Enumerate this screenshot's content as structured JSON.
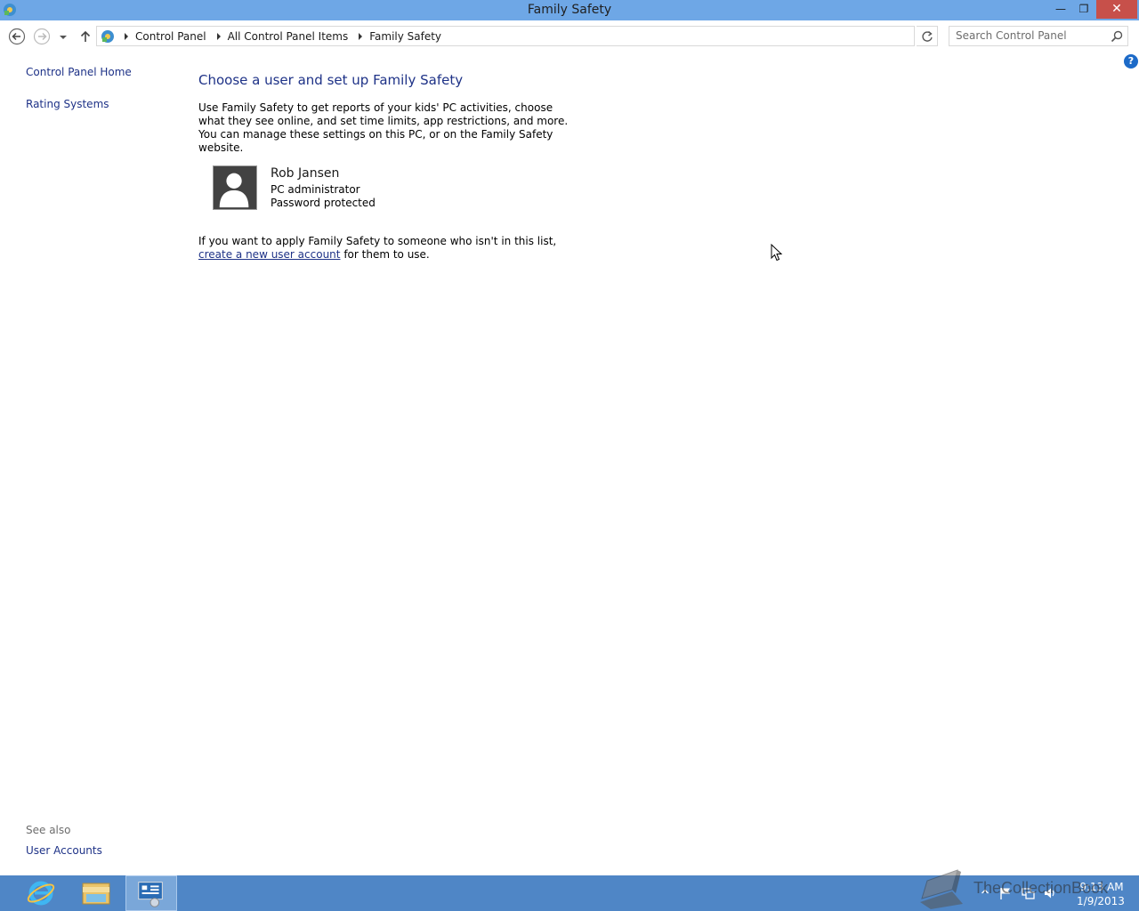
{
  "window": {
    "title": "Family Safety",
    "min_glyph": "—",
    "max_glyph": "❐",
    "close_glyph": "✕"
  },
  "address": {
    "crumbs": [
      "Control Panel",
      "All Control Panel Items",
      "Family Safety"
    ]
  },
  "search": {
    "placeholder": "Search Control Panel"
  },
  "leftnav": {
    "home": "Control Panel Home",
    "rating": "Rating Systems",
    "see_also": "See also",
    "user_accounts": "User Accounts"
  },
  "help": {
    "glyph": "?"
  },
  "main": {
    "heading": "Choose a user and set up Family Safety",
    "intro": "Use Family Safety to get reports of your kids' PC activities, choose what they see online, and set time limits, app restrictions, and more. You can manage these settings on this PC, or on the Family Safety website.",
    "user": {
      "name": "Rob Jansen",
      "role": "PC administrator",
      "status": "Password protected"
    },
    "apply_prefix": "If you want to apply Family Safety to someone who isn't in this list, ",
    "apply_link": "create a new user account",
    "apply_suffix": " for them to use."
  },
  "taskbar": {
    "time": "9:13 AM",
    "date": "1/9/2013"
  },
  "watermark": {
    "text": "TheCollectionBook"
  },
  "colors": {
    "titlebar": "#6ea7e6",
    "close": "#c7504a",
    "link": "#1e3287",
    "taskbar": "#4f86c6"
  },
  "icons": {
    "app": "control-panel-icon",
    "back": "back-arrow-icon",
    "forward": "forward-arrow-icon",
    "up": "up-arrow-icon",
    "refresh": "refresh-icon",
    "search": "search-icon",
    "help": "help-icon",
    "avatar": "user-silhouette-icon"
  }
}
